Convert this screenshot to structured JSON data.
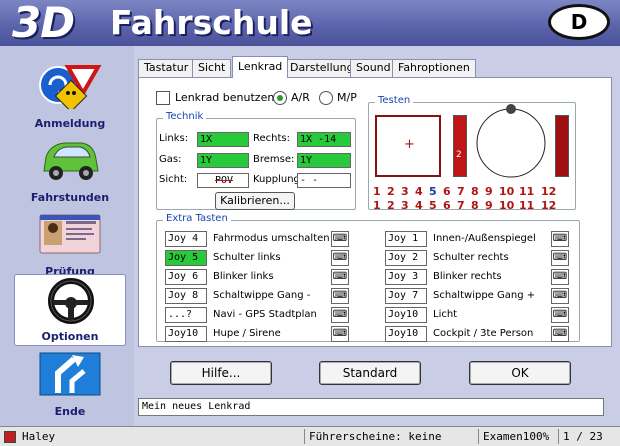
{
  "header": {
    "logo_3d": "3D",
    "app_name": "Fahrschule",
    "language_badge": "D"
  },
  "sidebar": {
    "items": [
      {
        "label": "Anmeldung",
        "icon": "road-signs-icon"
      },
      {
        "label": "Fahrstunden",
        "icon": "car-icon"
      },
      {
        "label": "Prüfung",
        "icon": "license-card-icon"
      },
      {
        "label": "Optionen",
        "icon": "steering-wheel-icon",
        "active": true
      },
      {
        "label": "Ende",
        "icon": "exit-sign-icon"
      }
    ]
  },
  "tabs": [
    "Tastatur",
    "Sicht",
    "Lenkrad",
    "Darstellung",
    "Sound",
    "Fahroptionen"
  ],
  "active_tab": "Lenkrad",
  "lenkrad": {
    "use_label": "Lenkrad benutzen",
    "use_checked": false,
    "radio_ar": "A/R",
    "radio_mp": "M/P",
    "radio_selected": "A/R"
  },
  "technik": {
    "title": "Technik",
    "links_label": "Links:",
    "links_value": "1X",
    "rechts_label": "Rechts:",
    "rechts_value": "1X   -14",
    "gas_label": "Gas:",
    "gas_value": "1Y",
    "bremse_label": "Bremse:",
    "bremse_value": "1Y",
    "sicht_label": "Sicht:",
    "sicht_value": "POV",
    "kupplung_label": "Kupplung:",
    "kupplung_value": "- -",
    "calibrate_button": "Kalibrieren..."
  },
  "testen": {
    "title": "Testen",
    "row1": [
      "1",
      "2",
      "3",
      "4",
      "5",
      "6",
      "7",
      "8",
      "9",
      "10",
      "11",
      "12"
    ],
    "row2": [
      "1",
      "2",
      "3",
      "4",
      "5",
      "6",
      "7",
      "8",
      "9",
      "10",
      "11",
      "12"
    ],
    "highlight_row1": "5",
    "bar_label": "2"
  },
  "extra_tasten": {
    "title": "Extra Tasten",
    "left": [
      {
        "joy": "Joy 4",
        "action": "Fahrmodus umschalten",
        "green": false
      },
      {
        "joy": "Joy 5",
        "action": "Schulter links",
        "green": true
      },
      {
        "joy": "Joy 6",
        "action": "Blinker links",
        "green": false
      },
      {
        "joy": "Joy 8",
        "action": "Schaltwippe Gang -",
        "green": false
      },
      {
        "joy": "...?",
        "action": "Navi - GPS Stadtplan",
        "green": false
      },
      {
        "joy": "Joy10",
        "action": "Hupe / Sirene",
        "green": false
      }
    ],
    "right": [
      {
        "joy": "Joy 1",
        "action": "Innen-/Außenspiegel"
      },
      {
        "joy": "Joy 2",
        "action": "Schulter rechts"
      },
      {
        "joy": "Joy 3",
        "action": "Blinker rechts"
      },
      {
        "joy": "Joy 7",
        "action": "Schaltwippe Gang +"
      },
      {
        "joy": "Joy10",
        "action": "Licht"
      },
      {
        "joy": "Joy10",
        "action": "Cockpit / 3te Person"
      }
    ]
  },
  "buttons": {
    "help": "Hilfe...",
    "standard": "Standard",
    "ok": "OK"
  },
  "status_text": "Mein neues Lenkrad",
  "status_bar": {
    "user": "Haley",
    "licenses": "Führerscheine: keine",
    "exam": "Examen100%",
    "page": "1 / 23"
  },
  "colors": {
    "accent_green": "#29c93c",
    "header_blue": "#5c65ab",
    "group_title_blue": "#1a45b5",
    "test_red": "#b01515"
  }
}
